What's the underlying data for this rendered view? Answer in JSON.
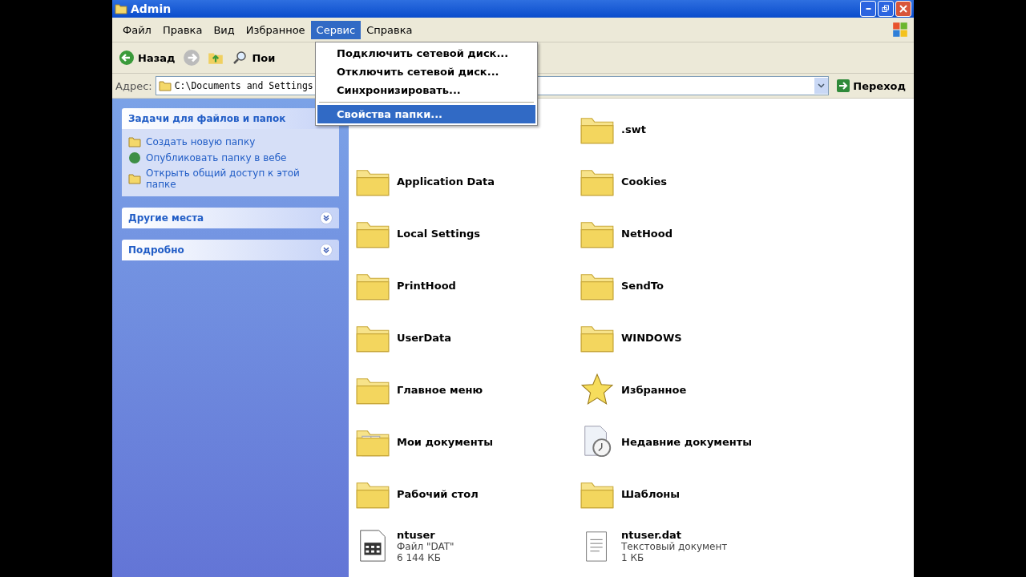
{
  "window": {
    "title": "Admin"
  },
  "menu_bar": [
    {
      "label": "Файл",
      "selected": false
    },
    {
      "label": "Правка",
      "selected": false
    },
    {
      "label": "Вид",
      "selected": false
    },
    {
      "label": "Избранное",
      "selected": false
    },
    {
      "label": "Сервис",
      "selected": true
    },
    {
      "label": "Справка",
      "selected": false
    }
  ],
  "toolbar": {
    "back": "Назад",
    "search": "Пои"
  },
  "address_bar": {
    "label": "Адрес:",
    "value": "C:\\Documents and Settings",
    "go": "Переход"
  },
  "open_menu": [
    {
      "kind": "item",
      "label": "Подключить сетевой диск...",
      "selected": false
    },
    {
      "kind": "item",
      "label": "Отключить сетевой диск...",
      "selected": false
    },
    {
      "kind": "item",
      "label": "Синхронизировать...",
      "selected": false
    },
    {
      "kind": "separator"
    },
    {
      "kind": "item",
      "label": "Свойства папки...",
      "selected": true
    }
  ],
  "task_pane": [
    {
      "title": "Задачи для файлов и папок",
      "expanded": true,
      "items": [
        "Создать новую папку",
        "Опубликовать папку в вебе",
        "Открыть общий доступ к этой папке"
      ]
    },
    {
      "title": "Другие места",
      "expanded": false
    },
    {
      "title": "Подробно",
      "expanded": false
    }
  ],
  "files": {
    "column_1": [
      {
        "kind": "folder",
        "name": "Application Data"
      },
      {
        "kind": "folder",
        "name": "Local Settings"
      },
      {
        "kind": "folder",
        "name": "PrintHood"
      },
      {
        "kind": "folder",
        "name": "UserData"
      },
      {
        "kind": "folder",
        "name": "Главное меню"
      },
      {
        "kind": "docs",
        "name": "Мои документы"
      },
      {
        "kind": "folder",
        "name": "Рабочий стол"
      },
      {
        "kind": "dat",
        "name": "ntuser",
        "details": [
          "Файл \"DAT\"",
          "6 144 КБ"
        ]
      }
    ],
    "column_2": [
      {
        "kind": "folder",
        "name": ".swt"
      },
      {
        "kind": "folder",
        "name": "Cookies"
      },
      {
        "kind": "folder",
        "name": "NetHood"
      },
      {
        "kind": "folder",
        "name": "SendTo"
      },
      {
        "kind": "folder",
        "name": "WINDOWS"
      },
      {
        "kind": "star",
        "name": "Избранное"
      },
      {
        "kind": "recent",
        "name": "Недавние документы"
      },
      {
        "kind": "folder",
        "name": "Шаблоны"
      },
      {
        "kind": "text",
        "name": "ntuser.dat",
        "details": [
          "Текстовый документ",
          "1 КБ"
        ]
      }
    ]
  }
}
